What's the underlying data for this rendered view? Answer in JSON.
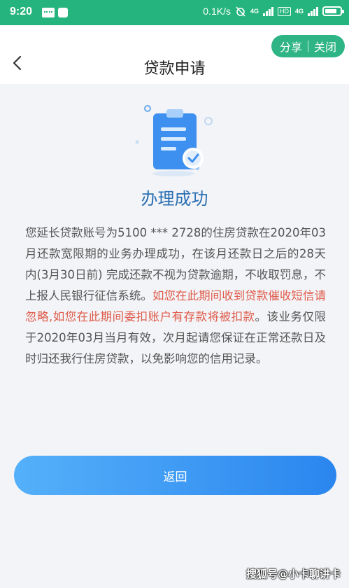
{
  "status_bar": {
    "time": "9:20",
    "network_speed": "0.1K/s",
    "signal_tag_1": "4G",
    "hd_badge": "HD",
    "signal_tag_2": "4G"
  },
  "header": {
    "title": "贷款申请",
    "share_label": "分享",
    "close_label": "关闭"
  },
  "result": {
    "title": "办理成功",
    "message_part1": "您延长贷款账号为5100 *** 2728的住房贷款在2020年03月还款宽限期的业务办理成功，在该月还款日之后的28天内(3月30日前) 完成还款不视为贷款逾期，不收取罚息，不上报人民银行征信系统。",
    "message_warning": "如您在此期间收到贷款催收短信请忽略,如您在此期间委扣账户有存款将被扣款",
    "message_part2": "。该业务仅限于2020年03月当月有效，次月起请您保证在正常还款日及时归还我行住房贷款，以免影响您的信用记录。"
  },
  "actions": {
    "back_label": "返回"
  },
  "watermark": "搜狐号@小卡聊讲卡",
  "colors": {
    "status_bar": "#26b47e",
    "capsule": "#2fb486",
    "title_blue": "#2a6fb2",
    "warning_red": "#e05a4a",
    "button_start": "#55b0fa",
    "button_end": "#2a86ee"
  }
}
